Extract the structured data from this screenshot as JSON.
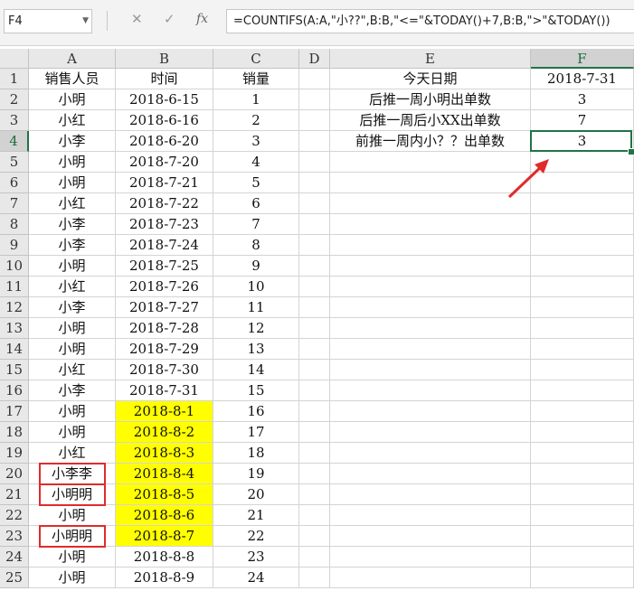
{
  "name_box": "F4",
  "formula_bar": {
    "cancel_glyph": "✕",
    "enter_glyph": "✓",
    "fx_label": "fx",
    "formula": "=COUNTIFS(A:A,\"小??\",B:B,\"<=\"&TODAY()+7,B:B,\">\"&TODAY())"
  },
  "columns": [
    "A",
    "B",
    "C",
    "D",
    "E",
    "F"
  ],
  "active_cell": "F4",
  "rows": [
    {
      "num": "1",
      "A": "销售人员",
      "B": "时间",
      "C": "销量",
      "E": "今天日期",
      "F": "2018-7-31"
    },
    {
      "num": "2",
      "A": "小明",
      "B": "2018-6-15",
      "C": "1",
      "E": "后推一周小明出单数",
      "F": "3"
    },
    {
      "num": "3",
      "A": "小红",
      "B": "2018-6-16",
      "C": "2",
      "E": "后推一周后小XX出单数",
      "F": "7"
    },
    {
      "num": "4",
      "A": "小李",
      "B": "2018-6-20",
      "C": "3",
      "E": "前推一周内小？？出单数",
      "F": "3"
    },
    {
      "num": "5",
      "A": "小明",
      "B": "2018-7-20",
      "C": "4"
    },
    {
      "num": "6",
      "A": "小明",
      "B": "2018-7-21",
      "C": "5"
    },
    {
      "num": "7",
      "A": "小红",
      "B": "2018-7-22",
      "C": "6"
    },
    {
      "num": "8",
      "A": "小李",
      "B": "2018-7-23",
      "C": "7"
    },
    {
      "num": "9",
      "A": "小李",
      "B": "2018-7-24",
      "C": "8"
    },
    {
      "num": "10",
      "A": "小明",
      "B": "2018-7-25",
      "C": "9"
    },
    {
      "num": "11",
      "A": "小红",
      "B": "2018-7-26",
      "C": "10"
    },
    {
      "num": "12",
      "A": "小李",
      "B": "2018-7-27",
      "C": "11"
    },
    {
      "num": "13",
      "A": "小明",
      "B": "2018-7-28",
      "C": "12"
    },
    {
      "num": "14",
      "A": "小明",
      "B": "2018-7-29",
      "C": "13"
    },
    {
      "num": "15",
      "A": "小红",
      "B": "2018-7-30",
      "C": "14"
    },
    {
      "num": "16",
      "A": "小李",
      "B": "2018-7-31",
      "C": "15"
    },
    {
      "num": "17",
      "A": "小明",
      "B": "2018-8-1",
      "C": "16",
      "hl": true
    },
    {
      "num": "18",
      "A": "小明",
      "B": "2018-8-2",
      "C": "17",
      "hl": true
    },
    {
      "num": "19",
      "A": "小红",
      "B": "2018-8-3",
      "C": "18",
      "hl": true
    },
    {
      "num": "20",
      "A": "小李李",
      "B": "2018-8-4",
      "C": "19",
      "hl": true,
      "box": true
    },
    {
      "num": "21",
      "A": "小明明",
      "B": "2018-8-5",
      "C": "20",
      "hl": true,
      "box": true
    },
    {
      "num": "22",
      "A": "小明",
      "B": "2018-8-6",
      "C": "21",
      "hl": true
    },
    {
      "num": "23",
      "A": "小明明",
      "B": "2018-8-7",
      "C": "22",
      "hl": true,
      "box": true
    },
    {
      "num": "24",
      "A": "小明",
      "B": "2018-8-8",
      "C": "23"
    },
    {
      "num": "25",
      "A": "小明",
      "B": "2018-8-9",
      "C": "24"
    }
  ],
  "colors": {
    "highlight": "#ffff00",
    "annotation_red": "#e02b2b",
    "selection_green": "#217346"
  }
}
